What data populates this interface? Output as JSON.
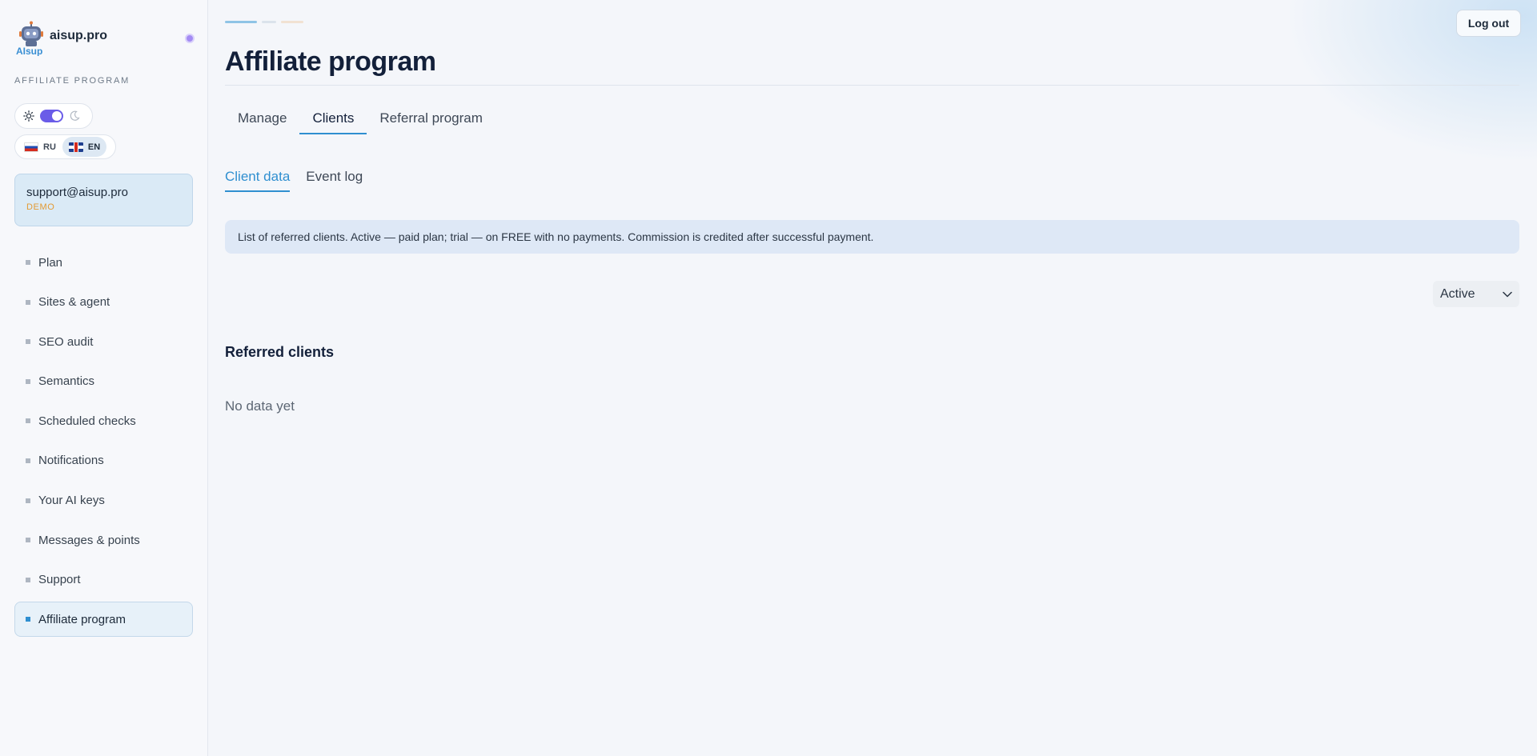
{
  "brand": {
    "name": "aisup.pro",
    "logo_text": "AIsup"
  },
  "sidebar": {
    "section_label": "AFFILIATE PROGRAM",
    "languages": [
      {
        "code": "RU",
        "active": false
      },
      {
        "code": "EN",
        "active": true
      }
    ],
    "user": {
      "email": "support@aisup.pro",
      "plan": "DEMO"
    },
    "nav": [
      {
        "label": "Plan"
      },
      {
        "label": "Sites & agent"
      },
      {
        "label": "SEO audit"
      },
      {
        "label": "Semantics"
      },
      {
        "label": "Scheduled checks"
      },
      {
        "label": "Notifications"
      },
      {
        "label": "Your AI keys"
      },
      {
        "label": "Messages & points"
      },
      {
        "label": "Support"
      },
      {
        "label": "Affiliate program",
        "active": true
      }
    ]
  },
  "header": {
    "logout_label": "Log out",
    "title": "Affiliate program"
  },
  "tabs": [
    {
      "label": "Manage"
    },
    {
      "label": "Clients",
      "active": true
    },
    {
      "label": "Referral program"
    }
  ],
  "subtabs": [
    {
      "label": "Client data",
      "active": true
    },
    {
      "label": "Event log"
    }
  ],
  "info_banner": "List of referred clients. Active — paid plan; trial — on FREE with no payments. Commission is credited after successful payment.",
  "filter": {
    "selected": "Active"
  },
  "referred_clients": {
    "title": "Referred clients",
    "empty_text": "No data yet"
  },
  "colors": {
    "accent": "#2f8fd0",
    "toggle": "#6a5ce8",
    "plan_badge": "#e39a32",
    "banner_bg": "#dee8f6"
  }
}
